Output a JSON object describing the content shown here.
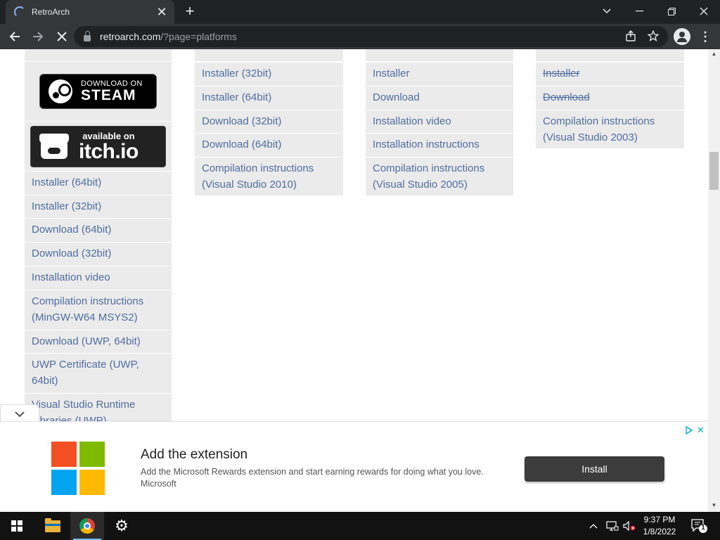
{
  "browser": {
    "tab_title": "RetroArch",
    "tab_close": "✕",
    "new_tab": "+",
    "url_host": "retroarch.com",
    "url_path": "/?page=platforms",
    "controls": {
      "dropdown": "⌄",
      "minimize": "—",
      "restore": "❐",
      "close": "✕"
    }
  },
  "columns": {
    "windows": {
      "steam_small": "DOWNLOAD ON",
      "steam_big": "STEAM",
      "itch_small": "available on",
      "itch_big": "itch.io",
      "items": [
        "Installer (64bit)",
        "Installer (32bit)",
        "Download (64bit)",
        "Download (32bit)",
        "Installation video",
        "Compilation instructions (MinGW-W64 MSYS2)",
        "Download (UWP, 64bit)",
        "UWP Certificate (UWP, 64bit)",
        "Visual Studio Runtime Libraries (UWP)"
      ]
    },
    "col2": {
      "items": [
        "Installer (32bit)",
        "Installer (64bit)",
        "Download (32bit)",
        "Download (64bit)",
        "Compilation instructions (Visual Studio 2010)"
      ]
    },
    "col3": {
      "items": [
        "Installer",
        "Download",
        "Installation video",
        "Installation instructions",
        "Compilation instructions (Visual Studio 2005)"
      ]
    },
    "col4": {
      "items": [
        "Installer",
        "Download",
        "Compilation instructions (Visual Studio 2003)"
      ],
      "struck": [
        true,
        true,
        false
      ]
    }
  },
  "ad": {
    "title": "Add the extension",
    "description": "Add the Microsoft Rewards extension and start earning rewards for doing what you love. Microsoft",
    "button": "Install",
    "close": "✕",
    "logo_colors": [
      "#f25022",
      "#7fba00",
      "#00a4ef",
      "#ffb900"
    ]
  },
  "taskbar": {
    "time": "9:37 PM",
    "date": "1/8/2022",
    "notification_count": "1"
  },
  "colors": {
    "link": "#4f6da0",
    "column_bg": "#ebebeb",
    "chrome_dark": "#202124",
    "chrome_toolbar": "#35363a"
  }
}
